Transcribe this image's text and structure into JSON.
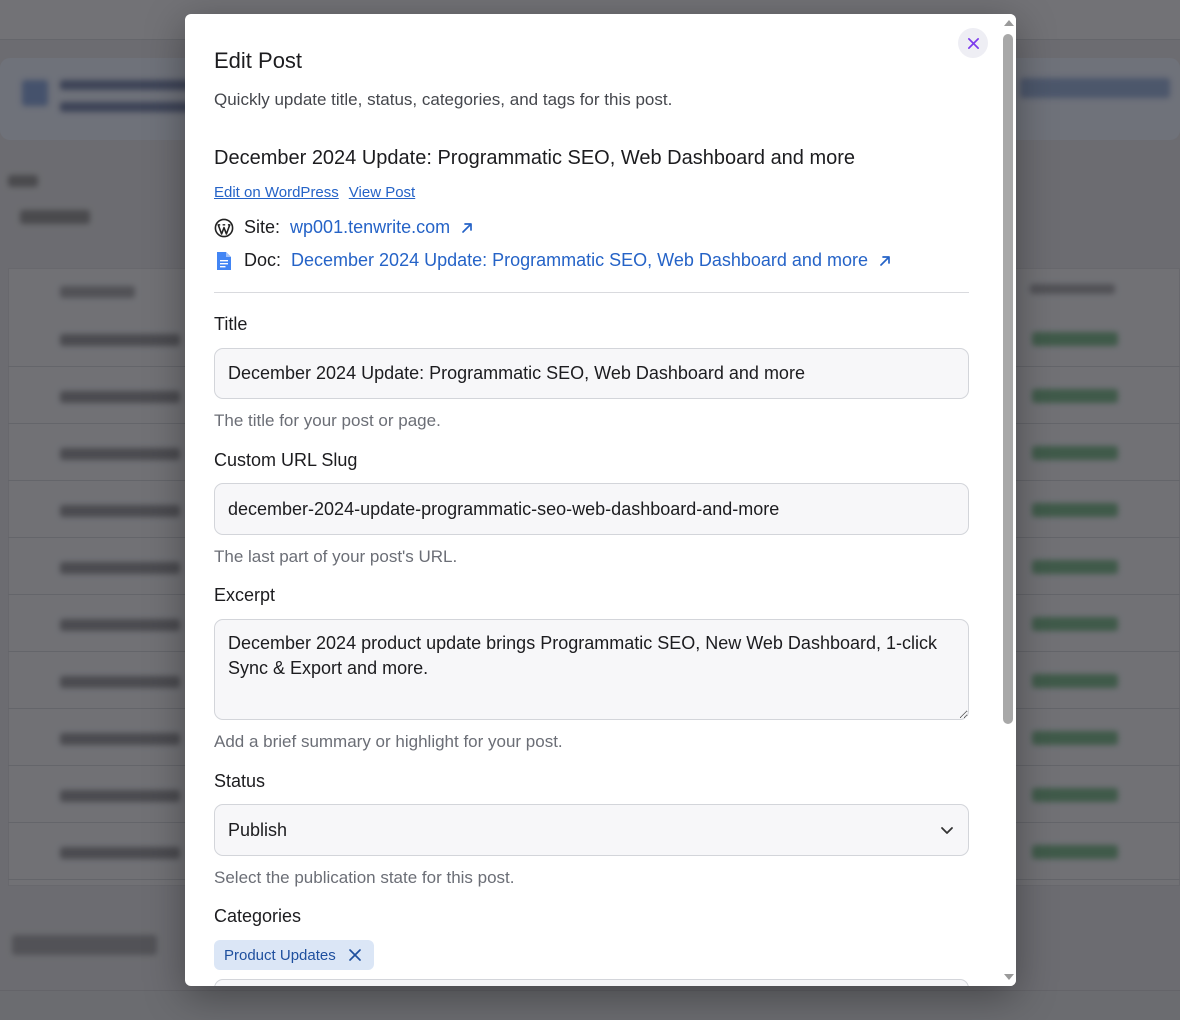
{
  "modal": {
    "title": "Edit Post",
    "subtitle": "Quickly update title, status, categories, and tags for this post."
  },
  "post": {
    "heading": "December 2024 Update: Programmatic SEO, Web Dashboard and more",
    "edit_link": "Edit on WordPress",
    "view_link": "View Post",
    "site_label": "Site:",
    "site_value": "wp001.tenwrite.com",
    "doc_label": "Doc:",
    "doc_value": "December 2024 Update: Programmatic SEO, Web Dashboard and more"
  },
  "form": {
    "title": {
      "label": "Title",
      "value": "December 2024 Update: Programmatic SEO, Web Dashboard and more",
      "help": "The title for your post or page."
    },
    "slug": {
      "label": "Custom URL Slug",
      "value": "december-2024-update-programmatic-seo-web-dashboard-and-more",
      "help": "The last part of your post's URL."
    },
    "excerpt": {
      "label": "Excerpt",
      "value": "December 2024 product update brings Programmatic SEO, New Web Dashboard, 1-click Sync & Export and more.",
      "help": "Add a brief summary or highlight for your post."
    },
    "status": {
      "label": "Status",
      "value": "Publish",
      "help": "Select the publication state for this post."
    },
    "categories": {
      "label": "Categories",
      "tags": [
        "Product Updates"
      ]
    }
  },
  "icons": {
    "close": "close-icon",
    "wordpress": "wordpress-icon",
    "doc": "google-doc-icon",
    "external": "external-link-icon",
    "chevron": "chevron-down-icon",
    "remove": "remove-tag-icon"
  },
  "colors": {
    "accent": "#2563c7",
    "close_icon": "#7c3aed",
    "tag_bg": "#dbe6f6",
    "doc_icon": "#4285f4"
  }
}
